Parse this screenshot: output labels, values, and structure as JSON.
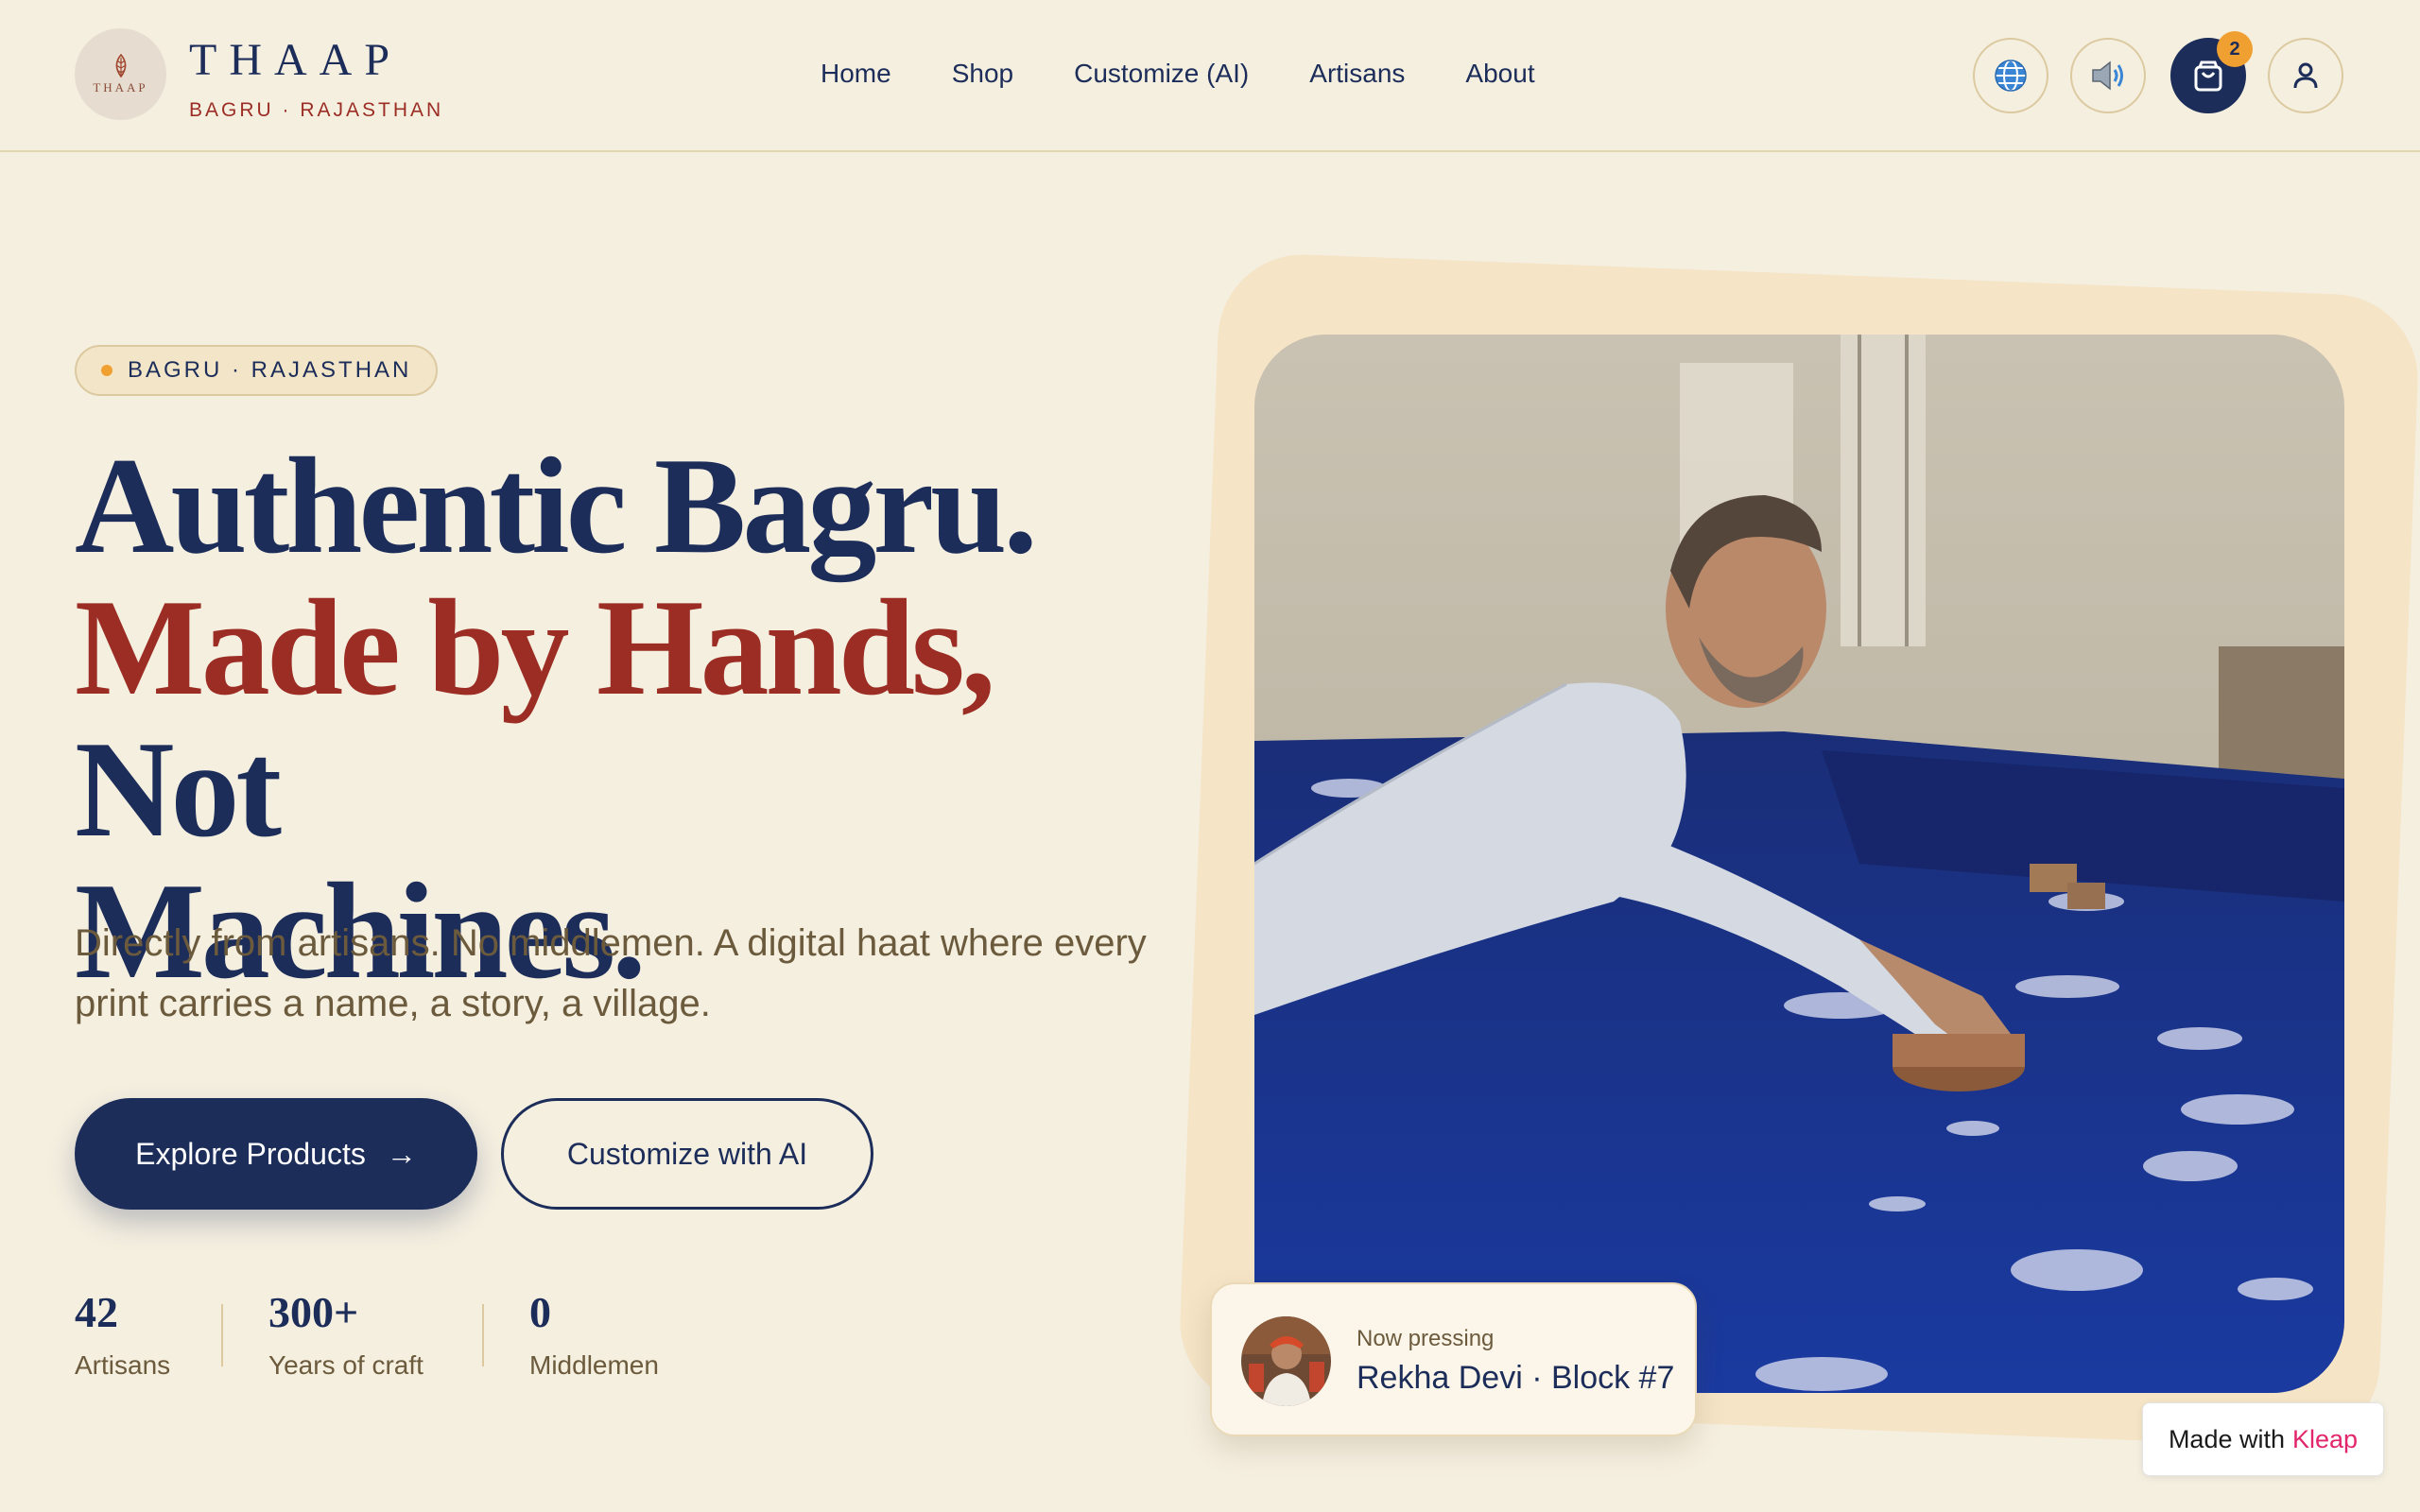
{
  "header": {
    "logo_mini": "THAAP",
    "brand_name": "THAAP",
    "brand_sub": "BAGRU · RAJASTHAN",
    "nav": [
      "Home",
      "Shop",
      "Customize (AI)",
      "Artisans",
      "About"
    ],
    "icons": [
      "globe-icon",
      "speaker-icon",
      "cart-icon",
      "user-icon"
    ],
    "cart_count": "2"
  },
  "hero": {
    "pill": "BAGRU · RAJASTHAN",
    "headline_line1": "Authentic Bagru.",
    "headline_red": "Made by Hands,",
    "headline_rest": " Not",
    "headline_line3": "Machines.",
    "lede": "Directly from artisans. No middlemen. A digital haat where every print carries a name, a story, a village.",
    "primary_cta": "Explore Products",
    "primary_cta_arrow": "→",
    "secondary_cta": "Customize with AI",
    "stats": [
      {
        "num": "42",
        "label": "Artisans"
      },
      {
        "num": "300+",
        "label": "Years of craft"
      },
      {
        "num": "0",
        "label": "Middlemen"
      }
    ]
  },
  "now_pressing": {
    "caption": "Now pressing",
    "who": "Rekha Devi · Block #7"
  },
  "badge": {
    "prefix": "Made with",
    "brand": "Kleap"
  },
  "colors": {
    "background": "#f5efe0",
    "navy": "#1c2d5a",
    "red": "#9b2d24",
    "accent_orange": "#f0a030",
    "fabric_blue": "#1c3a8c"
  }
}
